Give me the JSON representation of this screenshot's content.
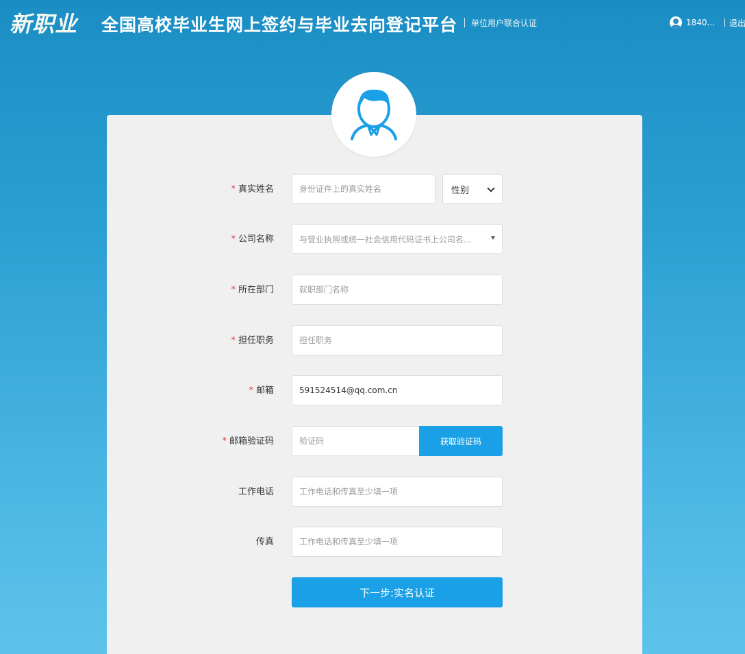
{
  "header": {
    "logo_text": "新职业",
    "platform_title": "全国高校毕业生网上签约与毕业去向登记平台",
    "unit_auth": "单位用户联合认证",
    "user_name": "1840...",
    "logout": "退出"
  },
  "form": {
    "real_name": {
      "label": "真实姓名",
      "placeholder": "身份证件上的真实姓名",
      "required": true
    },
    "gender": {
      "selected": "性别"
    },
    "company": {
      "label": "公司名称",
      "placeholder": "与营业执照或统一社会信用代码证书上公司名...",
      "required": true
    },
    "department": {
      "label": "所在部门",
      "placeholder": "就职部门名称",
      "required": true
    },
    "position": {
      "label": "担任职务",
      "placeholder": "担任职务",
      "required": true
    },
    "email": {
      "label": "邮箱",
      "value": "591524514@qq.com.cn",
      "required": true
    },
    "email_code": {
      "label": "邮箱验证码",
      "placeholder": "验证码",
      "button": "获取验证码",
      "required": true
    },
    "work_phone": {
      "label": "工作电话",
      "placeholder": "工作电话和传真至少填一项"
    },
    "fax": {
      "label": "传真",
      "placeholder": "工作电话和传真至少填一项"
    },
    "required_mark": "*"
  },
  "submit": {
    "label": "下一步:实名认证"
  },
  "colors": {
    "primary": "#1aa0e6",
    "required": "#e4393c",
    "card": "#f0f0f0"
  }
}
